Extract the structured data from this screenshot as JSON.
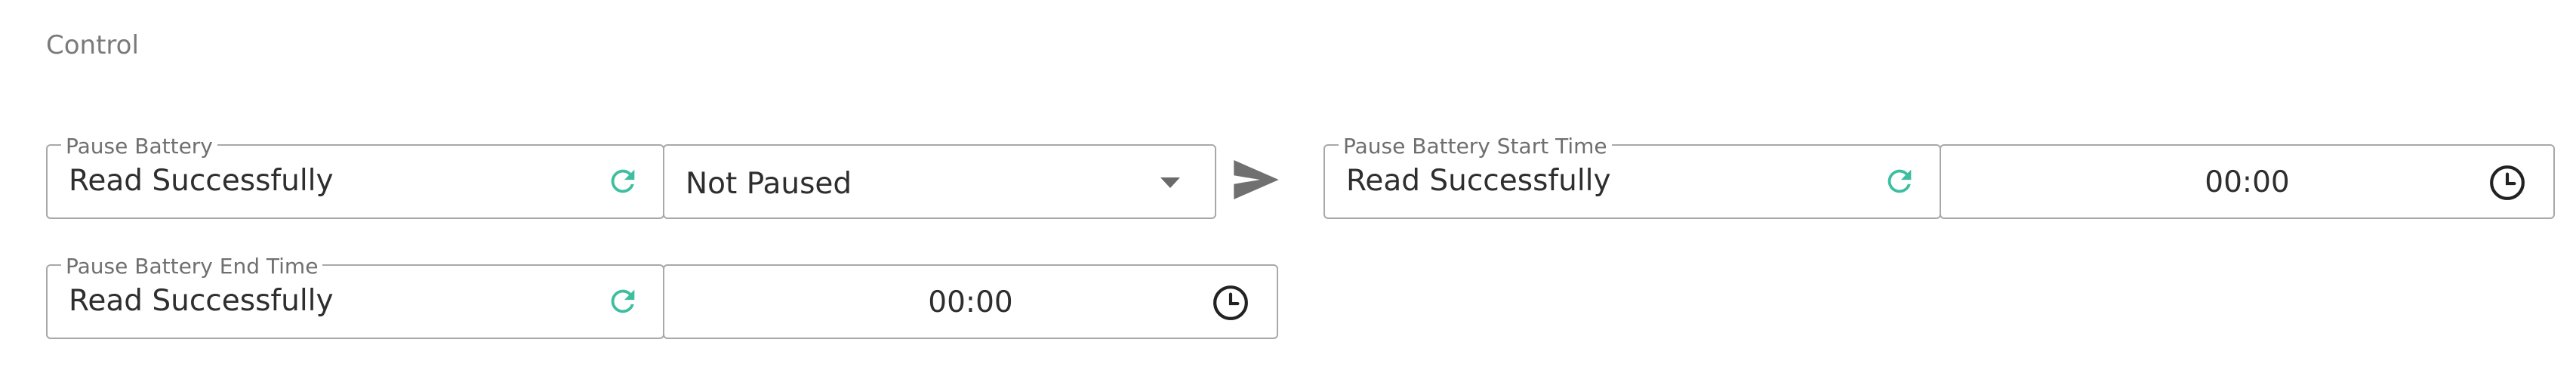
{
  "section": {
    "title": "Control"
  },
  "pause_battery": {
    "label": "Pause Battery",
    "status": "Read Successfully",
    "selected_option": "Not Paused"
  },
  "pause_start": {
    "label": "Pause Battery Start Time",
    "status": "Read Successfully",
    "time": "00:00"
  },
  "pause_end": {
    "label": "Pause Battery End Time",
    "status": "Read Successfully",
    "time": "00:00"
  },
  "icons": {
    "refresh": "refresh-icon",
    "send": "send-icon",
    "clock": "clock-icon",
    "dropdown": "chevron-down-icon"
  },
  "colors": {
    "accent": "#3dbf9f",
    "icon_gray": "#707070",
    "border": "#a8a8a8"
  }
}
